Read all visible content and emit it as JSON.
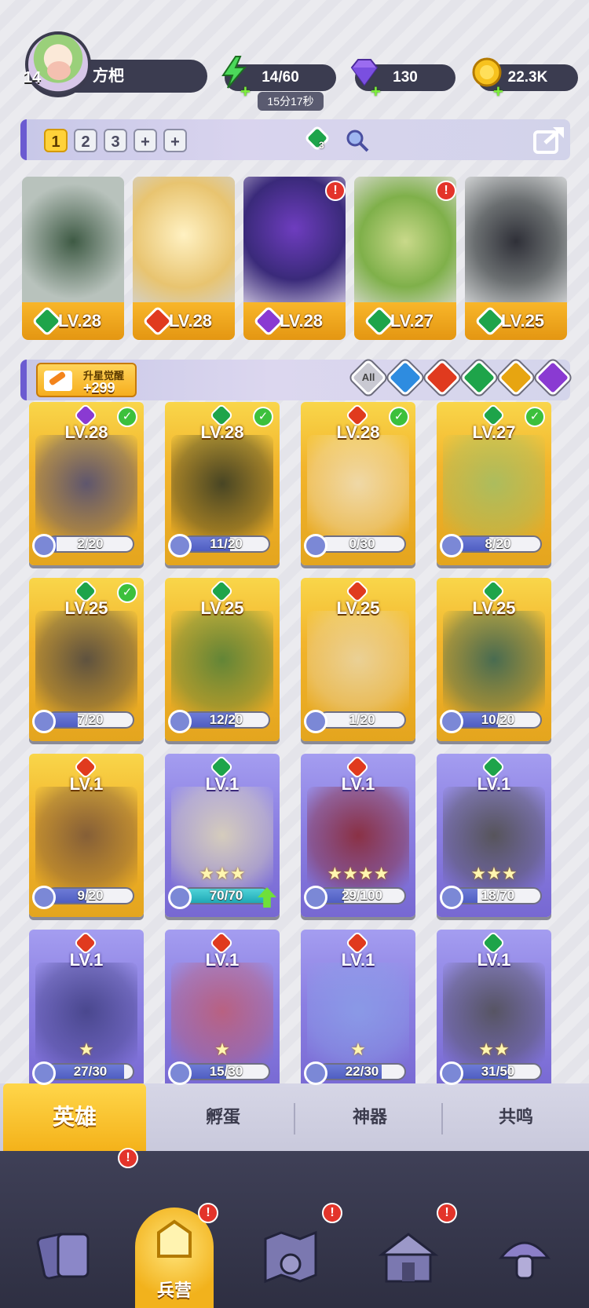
{
  "player": {
    "level": "14",
    "name": "方杷"
  },
  "resources": {
    "energy": "14/60",
    "energy_timer": "15分17秒",
    "gems": "130",
    "gold": "22.3K"
  },
  "team_bar": {
    "slots": [
      "1",
      "2",
      "3",
      "+",
      "+"
    ],
    "active_slot": "1",
    "badge_count": "3"
  },
  "team": [
    {
      "level": "LV.28",
      "element": "green"
    },
    {
      "level": "LV.28",
      "element": "red"
    },
    {
      "level": "LV.28",
      "element": "purple"
    },
    {
      "level": "LV.27",
      "element": "green"
    },
    {
      "level": "LV.25",
      "element": "green"
    }
  ],
  "filter_bar": {
    "upgrade_label": "升星觉醒",
    "upgrade_value": "+299",
    "filters": [
      "All",
      "blue",
      "red",
      "green",
      "yellow",
      "purple"
    ]
  },
  "heroes": [
    {
      "level": "LV.28",
      "element": "purple",
      "progress": "2/20",
      "ratio": 0.1,
      "checked": true,
      "frame": "gold",
      "stars": ""
    },
    {
      "level": "LV.28",
      "element": "green",
      "progress": "11/20",
      "ratio": 0.55,
      "checked": true,
      "frame": "gold",
      "stars": ""
    },
    {
      "level": "LV.28",
      "element": "red",
      "progress": "0/30",
      "ratio": 0,
      "checked": true,
      "frame": "gold",
      "stars": ""
    },
    {
      "level": "LV.27",
      "element": "green",
      "progress": "8/20",
      "ratio": 0.4,
      "checked": true,
      "frame": "gold",
      "stars": ""
    },
    {
      "level": "LV.25",
      "element": "green",
      "progress": "7/20",
      "ratio": 0.35,
      "checked": true,
      "frame": "gold",
      "stars": ""
    },
    {
      "level": "LV.25",
      "element": "green",
      "progress": "12/20",
      "ratio": 0.6,
      "checked": false,
      "frame": "gold",
      "stars": ""
    },
    {
      "level": "LV.25",
      "element": "red",
      "progress": "1/20",
      "ratio": 0.05,
      "checked": false,
      "frame": "gold",
      "stars": ""
    },
    {
      "level": "LV.25",
      "element": "green",
      "progress": "10/20",
      "ratio": 0.5,
      "checked": false,
      "frame": "gold",
      "stars": ""
    },
    {
      "level": "LV.1",
      "element": "red",
      "progress": "9/20",
      "ratio": 0.45,
      "checked": false,
      "frame": "gold",
      "stars": ""
    },
    {
      "level": "LV.1",
      "element": "green",
      "progress": "70/70",
      "ratio": 1,
      "checked": false,
      "frame": "purple",
      "stars": "★★★",
      "upgrade": true
    },
    {
      "level": "LV.1",
      "element": "red",
      "progress": "29/100",
      "ratio": 0.29,
      "checked": false,
      "frame": "purple",
      "stars": "★★★★"
    },
    {
      "level": "LV.1",
      "element": "green",
      "progress": "18/70",
      "ratio": 0.26,
      "checked": false,
      "frame": "purple",
      "stars": "★★★"
    },
    {
      "level": "LV.1",
      "element": "red",
      "progress": "27/30",
      "ratio": 0.9,
      "checked": false,
      "frame": "purple",
      "stars": "★"
    },
    {
      "level": "LV.1",
      "element": "red",
      "progress": "15/30",
      "ratio": 0.5,
      "checked": false,
      "frame": "purple",
      "stars": "★"
    },
    {
      "level": "LV.1",
      "element": "red",
      "progress": "22/30",
      "ratio": 0.73,
      "checked": false,
      "frame": "purple",
      "stars": "★"
    },
    {
      "level": "LV.1",
      "element": "green",
      "progress": "31/50",
      "ratio": 0.62,
      "checked": false,
      "frame": "purple",
      "stars": "★★"
    }
  ],
  "tabs": {
    "heroes": "英雄",
    "hatch": "孵蛋",
    "artifact": "神器",
    "resonance": "共鸣"
  },
  "nav": {
    "barracks": "兵营"
  },
  "colors": {
    "gold": "#f2b42c",
    "purple": "#8b7fe2",
    "green": "#1ea44a",
    "red": "#e03a1e",
    "violet": "#8a3ad2",
    "navbar": "#34354a"
  }
}
